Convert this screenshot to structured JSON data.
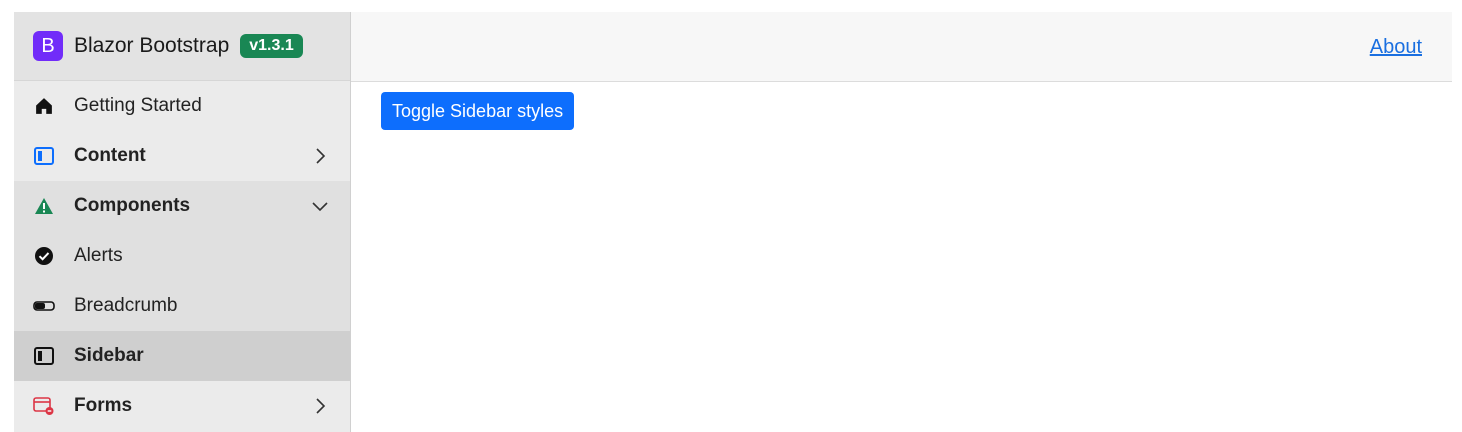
{
  "brand": {
    "logo_letter": "B",
    "name": "Blazor Bootstrap",
    "version": "v1.3.1",
    "logo_color": "#712cf9",
    "badge_color": "#198754"
  },
  "sidebar": {
    "items": [
      {
        "label": "Getting Started",
        "icon": "house-icon",
        "state": "normal"
      },
      {
        "label": "Content",
        "icon": "layout-sidebar-icon",
        "state": "collapsed",
        "chevron": "chevron-right-icon"
      },
      {
        "label": "Components",
        "icon": "warning-triangle-icon",
        "state": "expanded",
        "chevron": "chevron-down-icon"
      },
      {
        "label": "Alerts",
        "icon": "check-circle-icon",
        "state": "sub"
      },
      {
        "label": "Breadcrumb",
        "icon": "toggle-icon",
        "state": "sub"
      },
      {
        "label": "Sidebar",
        "icon": "sidebar-icon",
        "state": "active"
      },
      {
        "label": "Forms",
        "icon": "form-window-icon",
        "state": "collapsed",
        "chevron": "chevron-right-icon"
      }
    ]
  },
  "topbar": {
    "about_label": "About",
    "link_color": "#1a6fe0"
  },
  "main": {
    "toggle_button_label": "Toggle Sidebar styles",
    "button_color": "#0d6efd"
  }
}
